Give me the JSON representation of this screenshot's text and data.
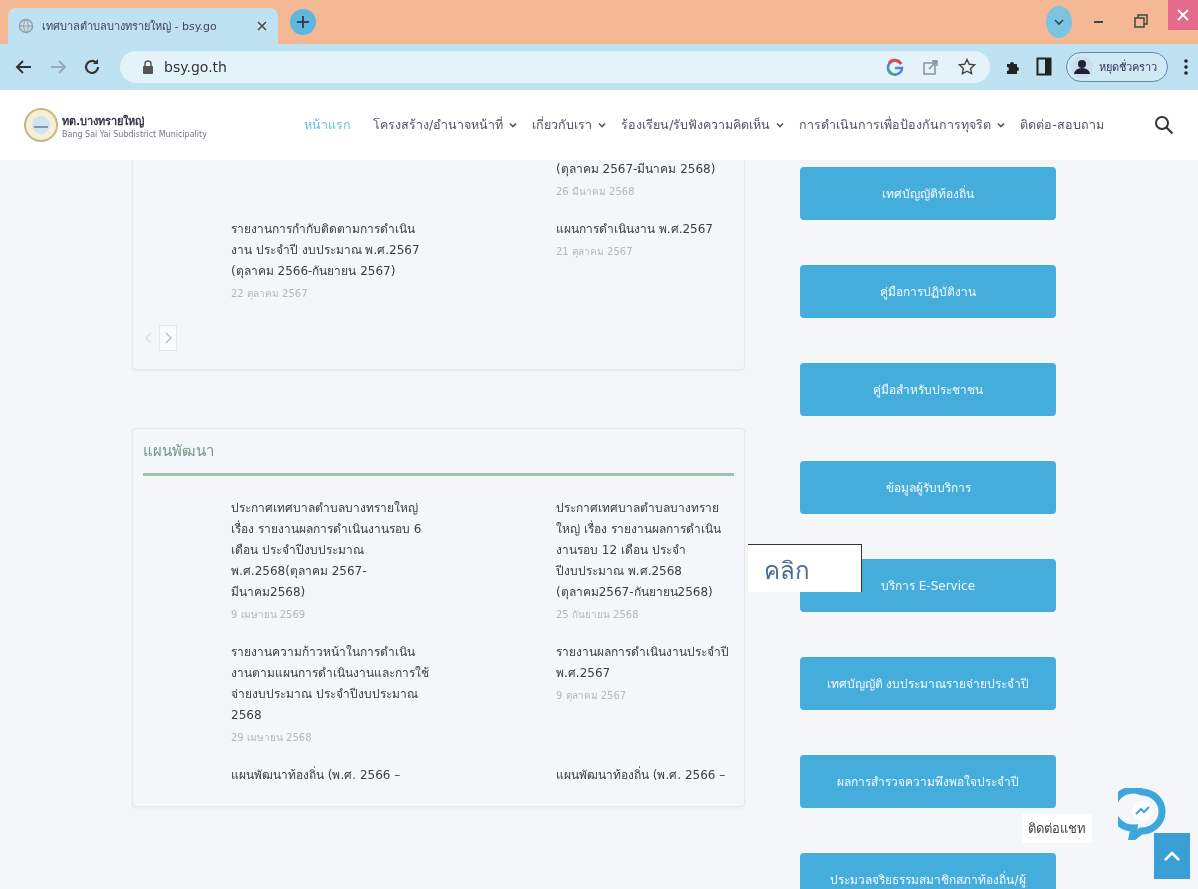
{
  "browser": {
    "tab_title": "เทศบาลตำบลบางทรายใหญ่ - bsy.go",
    "address": "bsy.go.th",
    "profile_label": "หยุดชั่วคราว"
  },
  "site_header": {
    "logo_title": "ทต.บางทรายใหญ่",
    "logo_subtitle": "Bang Sai Yai Subdistrict Municipality",
    "nav": [
      {
        "label": "หน้าแรก",
        "selected": true,
        "dropdown": false
      },
      {
        "label": "โครงสร้าง/อำนาจหน้าที่",
        "selected": false,
        "dropdown": true
      },
      {
        "label": "เกี่ยวกับเรา",
        "selected": false,
        "dropdown": true
      },
      {
        "label": "ร้องเรียน/รับฟังความคิดเห็น",
        "selected": false,
        "dropdown": true
      },
      {
        "label": "การดำเนินการเพื่อป้องกันการทุจริต",
        "selected": false,
        "dropdown": true
      },
      {
        "label": "ติดต่อ-สอบถาม",
        "selected": false,
        "dropdown": false
      }
    ]
  },
  "cards": [
    {
      "pager": true,
      "rows": [
        {
          "right": {
            "title": "(ตุลาคม 2567-มีนาคม 2568)",
            "date": "26 มีนาคม 2568"
          }
        },
        {
          "left": {
            "title": "รายงานการกำกับติดตามการดำเนินงาน ประจำปี งบประมาณ พ.ศ.2567 (ตุลาคม 2566-กันยายน 2567)",
            "date": "22 ตุลาคม 2567"
          },
          "right": {
            "title": "แผนการดำเนินงาน พ.ศ.2567",
            "date": "21 ตุลาคม 2567"
          }
        }
      ]
    },
    {
      "title": "แผนพัฒนา",
      "pager": false,
      "rows": [
        {
          "left": {
            "title": "ประกาศเทศบาลตำบลบางทรายใหญ่ เรื่อง รายงานผลการดำเนินงานรอบ 6 เดือน ประจำปีงบประมาณ พ.ศ.2568(ตุลาคม 2567-มีนาคม2568)",
            "date": "9 เมษายน 2569"
          },
          "right": {
            "title": "ประกาศเทศบาลตำบลบางทรายใหญ่ เรื่อง รายงานผลการดำเนินงานรอบ 12 เดือน ประจำปีงบประมาณ พ.ศ.2568 (ตุลาคม2567-กันยายน2568)",
            "date": "25 กันยายน 2568"
          }
        },
        {
          "left": {
            "title": "รายงานความก้าวหน้าในการดำเนินงานตามแผนการดำเนินงานและการใช้จ่ายงบประมาณ ประจำปีงบประมาณ 2568",
            "date": "29 เมษายน 2568"
          },
          "right": {
            "title": "รายงานผลการดำเนินงานประจำปี พ.ศ.2567",
            "date": "9 ตุลาคม 2567"
          }
        },
        {
          "left": {
            "title": "แผนพัฒนาท้องถิ่น (พ.ศ. 2566 –"
          },
          "right": {
            "title": "แผนพัฒนาท้องถิ่น (พ.ศ. 2566 –"
          }
        }
      ]
    }
  ],
  "sidebar_buttons": [
    "เทศบัญญัติท้องถิ่น",
    "คู่มือการปฏิบัติงาน",
    "คู่มือสำหรับประชาชน",
    "ข้อมูลผู้รับบริการ",
    "บริการ E-Service",
    "เทศบัญญัติ งบประมาณรายจ่ายประจำปี",
    "ผลการสำรวจความพึงพอใจประจำปี",
    "ประมวลจริยธรรมสมาชิกสภาท้องถิ่น/ผู้"
  ],
  "annotation": {
    "text": "คลิก"
  },
  "chat": {
    "label": "ติดต่อแชท"
  }
}
